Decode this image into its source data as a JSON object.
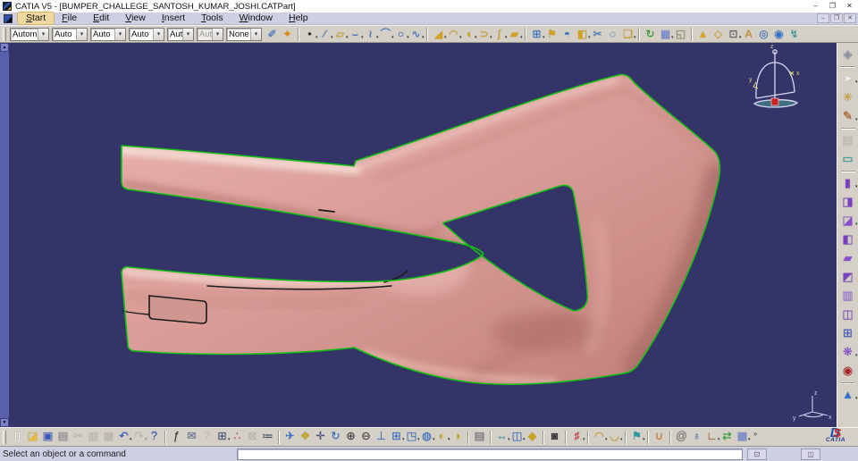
{
  "window": {
    "title": "CATIA V5 - [BUMPER_CHALLEGE_SANTOSH_KUMAR_JOSHI.CATPart]",
    "controls": [
      {
        "name": "minimize-button",
        "glyph": "–"
      },
      {
        "name": "maximize-button",
        "glyph": "❐"
      },
      {
        "name": "close-button",
        "glyph": "✕"
      }
    ]
  },
  "menu": {
    "items": [
      {
        "name": "menu-start",
        "label": "Start",
        "highlight": true
      },
      {
        "name": "menu-file",
        "label": "File"
      },
      {
        "name": "menu-edit",
        "label": "Edit"
      },
      {
        "name": "menu-view",
        "label": "View"
      },
      {
        "name": "menu-insert",
        "label": "Insert"
      },
      {
        "name": "menu-tools",
        "label": "Tools"
      },
      {
        "name": "menu-window",
        "label": "Window"
      },
      {
        "name": "menu-help",
        "label": "Help"
      }
    ],
    "mdi_controls": [
      {
        "name": "doc-minimize-button",
        "glyph": "–"
      },
      {
        "name": "doc-restore-button",
        "glyph": "❐"
      },
      {
        "name": "doc-close-button",
        "glyph": "✕"
      }
    ]
  },
  "top_toolbar": {
    "combos": [
      {
        "name": "filter-combo-1",
        "value": "Autom:"
      },
      {
        "name": "filter-combo-2",
        "value": "Auto"
      },
      {
        "name": "filter-combo-3",
        "value": "Auto"
      },
      {
        "name": "filter-combo-4",
        "value": "Auto"
      },
      {
        "name": "filter-combo-5",
        "value": "Aut"
      },
      {
        "name": "filter-combo-6",
        "value": "Aut",
        "disabled": true
      },
      {
        "name": "filter-combo-7",
        "value": "None"
      }
    ],
    "icons": [
      {
        "name": "graph-paint-icon",
        "glyph": "✐",
        "color": "#2f6fd0"
      },
      {
        "name": "magic-wand-icon",
        "glyph": "✦",
        "color": "#e88a00"
      },
      {
        "sep": true
      },
      {
        "name": "point-icon",
        "glyph": "•",
        "color": "#222222",
        "fly": true
      },
      {
        "name": "line-icon",
        "glyph": "∕",
        "color": "#2f6fd0",
        "fly": true
      },
      {
        "name": "plane-icon",
        "glyph": "▱",
        "color": "#d4a017",
        "fly": true
      },
      {
        "name": "projection-icon",
        "glyph": "⌣",
        "color": "#2f6fd0",
        "fly": true
      },
      {
        "name": "sweep-curve-icon",
        "glyph": "≀",
        "color": "#2f6fd0",
        "fly": true
      },
      {
        "name": "corner-icon",
        "glyph": "⌒",
        "color": "#2f6fd0",
        "fly": true
      },
      {
        "name": "circle-icon",
        "glyph": "○",
        "color": "#2f6fd0",
        "fly": true
      },
      {
        "name": "spline-icon",
        "glyph": "∿",
        "color": "#2f6fd0",
        "fly": true
      },
      {
        "sep": true
      },
      {
        "name": "extrude-surface-icon",
        "glyph": "◢",
        "color": "#d8a018",
        "fly": true
      },
      {
        "name": "revolve-surface-icon",
        "glyph": "◠",
        "color": "#d8a018",
        "fly": true
      },
      {
        "name": "sphere-surface-icon",
        "glyph": "◖",
        "color": "#d8a018",
        "fly": true
      },
      {
        "name": "offset-surface-icon",
        "glyph": "⊃",
        "color": "#d8a018",
        "fly": true
      },
      {
        "name": "sweep-surface-icon",
        "glyph": "∫",
        "color": "#d8a018",
        "fly": true
      },
      {
        "name": "fill-surface-icon",
        "glyph": "▰",
        "color": "#d8a018",
        "fly": true
      },
      {
        "sep": true
      },
      {
        "name": "join-surfaces-icon",
        "glyph": "⊞",
        "color": "#2f6fd0",
        "fly": true
      },
      {
        "name": "healing-icon",
        "glyph": "⚑",
        "color": "#d4a017"
      },
      {
        "name": "untrim-icon",
        "glyph": "◓",
        "color": "#2f6fd0"
      },
      {
        "name": "split-icon",
        "glyph": "◧",
        "color": "#d4a017",
        "fly": true
      },
      {
        "name": "trim-icon",
        "glyph": "✂",
        "color": "#2f6fd0"
      },
      {
        "name": "boundary-icon",
        "glyph": "◌",
        "color": "#2f6fd0"
      },
      {
        "name": "extract-icon",
        "glyph": "❏",
        "color": "#d4a017",
        "fly": true
      },
      {
        "sep": true
      },
      {
        "name": "update-icon",
        "glyph": "↻",
        "color": "#2a9a2a"
      },
      {
        "name": "grid-snap-icon",
        "glyph": "▦",
        "color": "#6f84d8",
        "fly": true
      },
      {
        "name": "mask-icon",
        "glyph": "◱",
        "color": "#8a8f50"
      },
      {
        "sep": true
      },
      {
        "name": "cone-analysis-icon",
        "glyph": "▲",
        "color": "#e0a020"
      },
      {
        "name": "facet-icon",
        "glyph": "◇",
        "color": "#e0a020"
      },
      {
        "name": "light-source-icon",
        "glyph": "⊡",
        "color": "#55585e",
        "fly": true
      },
      {
        "name": "text-annotation-icon",
        "glyph": "A",
        "color": "#c89010"
      },
      {
        "name": "circle-target-icon",
        "glyph": "◎",
        "color": "#2f6fd0"
      },
      {
        "name": "boxed-sphere-icon",
        "glyph": "◉",
        "color": "#2f6fd0"
      },
      {
        "name": "small-axis-icon",
        "glyph": "↯",
        "color": "#2a9aa0"
      }
    ]
  },
  "right_toolbar": {
    "icons": [
      {
        "name": "workbench-icon",
        "glyph": "◈",
        "color": "#8a8fa0"
      },
      {
        "sep": true
      },
      {
        "name": "select-icon",
        "glyph": "➤",
        "color": "#efefef",
        "fly": true
      },
      {
        "name": "smart-pick-icon",
        "glyph": "✳",
        "color": "#d4a017"
      },
      {
        "name": "sketcher-icon",
        "glyph": "✎",
        "color": "#b05010",
        "fly": true
      },
      {
        "sep": true
      },
      {
        "name": "work-support-icon",
        "glyph": "▤",
        "color": "#9a9a9a",
        "disabled": true
      },
      {
        "name": "plane-view-icon",
        "glyph": "▭",
        "color": "#2a9aa0"
      },
      {
        "sep": true
      },
      {
        "name": "pad-icon",
        "glyph": "▮",
        "color": "#7b3fc4",
        "fly": true
      },
      {
        "name": "drafted-pad-icon",
        "glyph": "◨",
        "color": "#7b3fc4"
      },
      {
        "name": "multi-pad-icon",
        "glyph": "◪",
        "color": "#8a4fd0",
        "fly": true
      },
      {
        "name": "pocket-icon",
        "glyph": "◧",
        "color": "#7b3fc4"
      },
      {
        "name": "shaft-icon",
        "glyph": "▰",
        "color": "#8a4fd0"
      },
      {
        "name": "groove-icon",
        "glyph": "◩",
        "color": "#7b3fc4"
      },
      {
        "name": "rib-icon",
        "glyph": "▥",
        "color": "#9a6fe0"
      },
      {
        "name": "slot-icon",
        "glyph": "◫",
        "color": "#7b3fc4"
      },
      {
        "name": "catalog-icon",
        "glyph": "⊞",
        "color": "#3a57c0"
      },
      {
        "name": "pattern-icon",
        "glyph": "❋",
        "color": "#8a4fd0",
        "fly": true
      },
      {
        "name": "record-icon",
        "glyph": "◉",
        "color": "#b02020"
      },
      {
        "sep": true
      },
      {
        "name": "constraint-cone-icon",
        "glyph": "▲",
        "color": "#2f6fd0",
        "fly": true
      }
    ]
  },
  "bottom_toolbar": {
    "icons": [
      {
        "name": "new-document-icon",
        "glyph": "▯",
        "color": "#ffffff"
      },
      {
        "name": "open-folder-icon",
        "glyph": "◪",
        "color": "#e8b93c"
      },
      {
        "name": "save-icon",
        "glyph": "▣",
        "color": "#3a57c0"
      },
      {
        "name": "print-icon",
        "glyph": "▤",
        "color": "#8b8f96"
      },
      {
        "name": "cut-icon",
        "glyph": "✂",
        "color": "#9a9a9a",
        "disabled": true
      },
      {
        "name": "copy-icon",
        "glyph": "▥",
        "color": "#9a9a9a",
        "disabled": true
      },
      {
        "name": "paste-icon",
        "glyph": "▦",
        "color": "#9a9a9a",
        "disabled": true
      },
      {
        "name": "undo-icon",
        "glyph": "↶",
        "color": "#2f55cc",
        "fly": true
      },
      {
        "name": "redo-icon",
        "glyph": "↷",
        "color": "#9a9a9a",
        "disabled": true,
        "fly": true
      },
      {
        "name": "whats-this-icon",
        "glyph": "?",
        "color": "#2f55cc"
      },
      {
        "sep": true
      },
      {
        "name": "formula-icon",
        "glyph": "ƒ",
        "color": "#333333"
      },
      {
        "name": "comment-icon",
        "glyph": "✉",
        "color": "#667799"
      },
      {
        "name": "help-query-icon",
        "glyph": "?",
        "color": "#aaaaaa",
        "disabled": true
      },
      {
        "name": "design-table-icon",
        "glyph": "⊞",
        "color": "#445577",
        "fly": true
      },
      {
        "name": "product-structure-icon",
        "glyph": "∴",
        "color": "#cc4433"
      },
      {
        "name": "lock-icon",
        "glyph": "⊠",
        "color": "#999999",
        "disabled": true
      },
      {
        "name": "equation-icon",
        "glyph": "≔",
        "color": "#334466"
      },
      {
        "sep": true
      },
      {
        "name": "fly-mode-icon",
        "glyph": "✈",
        "color": "#2f6fd0"
      },
      {
        "name": "fit-all-icon",
        "glyph": "❖",
        "color": "#c8a61c"
      },
      {
        "name": "pan-icon",
        "glyph": "✛",
        "color": "#44507a"
      },
      {
        "name": "rotate-icon",
        "glyph": "↻",
        "color": "#2f6fd0"
      },
      {
        "name": "zoom-in-icon",
        "glyph": "⊕",
        "color": "#3a3f45"
      },
      {
        "name": "zoom-out-icon",
        "glyph": "⊖",
        "color": "#3a3f45"
      },
      {
        "name": "normal-view-icon",
        "glyph": "⊥",
        "color": "#2f6fd0"
      },
      {
        "name": "multi-view-icon",
        "glyph": "⊞",
        "color": "#2f6fd0",
        "fly": true
      },
      {
        "name": "iso-view-icon",
        "glyph": "◳",
        "color": "#2f6fd0",
        "fly": true
      },
      {
        "name": "render-style-icon",
        "glyph": "◍",
        "color": "#2f6fd0",
        "fly": true
      },
      {
        "name": "hide-show-icon",
        "glyph": "◐",
        "color": "#c8a61c",
        "fly": true
      },
      {
        "name": "swap-space-icon",
        "glyph": "◑",
        "color": "#c8a61c"
      },
      {
        "sep": true
      },
      {
        "name": "capture-icon",
        "glyph": "▤",
        "color": "#6a6f76"
      },
      {
        "sep": true
      },
      {
        "name": "measure-between-icon",
        "glyph": "↔",
        "color": "#2a9aa0",
        "fly": true
      },
      {
        "name": "measure-item-icon",
        "glyph": "◫",
        "color": "#2f6fd0",
        "fly": true
      },
      {
        "name": "mass-properties-icon",
        "glyph": "◆",
        "color": "#c8a61c"
      },
      {
        "sep": true
      },
      {
        "name": "camera-icon",
        "glyph": "◙",
        "color": "#333333"
      },
      {
        "sep": true
      },
      {
        "name": "constraint-icon",
        "glyph": "♯",
        "color": "#cc3333",
        "fly": true
      },
      {
        "sep": true
      },
      {
        "name": "connect-checker-icon",
        "glyph": "◠",
        "color": "#d8a018",
        "fly": true
      },
      {
        "name": "curvature-analysis-icon",
        "glyph": "◡",
        "color": "#d8a018",
        "fly": true
      },
      {
        "sep": true
      },
      {
        "name": "surface-analysis-icon",
        "glyph": "⚑",
        "color": "#2a9aa0",
        "fly": true
      },
      {
        "sep": true
      },
      {
        "name": "draft-analysis-icon",
        "glyph": "∪",
        "color": "#d87818"
      },
      {
        "sep": true
      },
      {
        "name": "link-icon",
        "glyph": "@",
        "color": "#777777"
      },
      {
        "name": "www-icon",
        "glyph": "♁",
        "color": "#2f6fd0"
      },
      {
        "name": "axis-system-icon",
        "glyph": "∟",
        "color": "#b05010",
        "fly": true
      },
      {
        "name": "exchange-icon",
        "glyph": "⇄",
        "color": "#2aa02a"
      },
      {
        "name": "grid-icon",
        "glyph": "▦",
        "color": "#6f84d8",
        "fly": true
      }
    ],
    "overflow_label": "»",
    "logo": {
      "d": "D",
      "s": "S",
      "label": "CATIA"
    }
  },
  "status_bar": {
    "message": "Select an object or a command",
    "input_value": "",
    "buttons": [
      {
        "name": "status-expand-button",
        "glyph": "⊡"
      },
      {
        "name": "status-doc-button",
        "glyph": "◫"
      }
    ]
  },
  "viewport": {
    "tree_strip": {
      "up_glyph": "▲",
      "down_glyph": "▼"
    },
    "compass": {
      "z": "z",
      "x": "x",
      "y": "y"
    },
    "triad": {
      "z": "z",
      "x": "x",
      "y": "y"
    }
  },
  "colors": {
    "titlebar_bg": "#ffffff",
    "menubar_bg": "#cfcfe3",
    "toolbar_bg": "#d4d0c8",
    "viewport_bg": "#343468",
    "left_strip": "#5a5fae",
    "accent_select": "#eed9a0",
    "model_body": "#d89a95",
    "model_highlight": "#f6ded8",
    "model_shadow": "#a96b66",
    "edge_green": "#12c112",
    "compass_line": "#d8d8f2",
    "compass_label": "#d8d878",
    "compass_base": "#3f6e7e",
    "compass_anchor": "#cc2020"
  }
}
